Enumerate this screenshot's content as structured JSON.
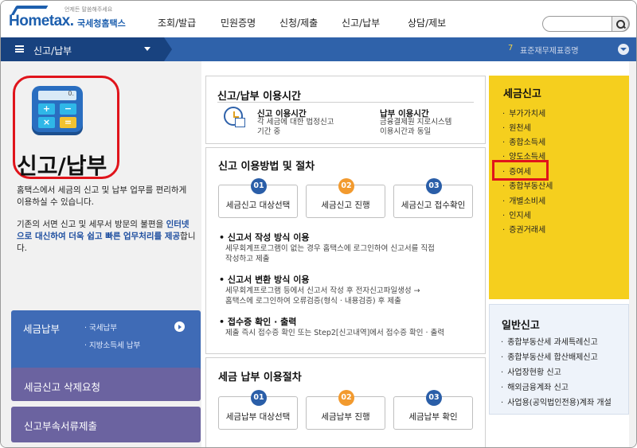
{
  "header": {
    "logo_main": "Hometax.",
    "logo_sub": "국세청홈택스",
    "logo_tagline": "언제든 말씀해주세요",
    "nav": [
      "조회/발급",
      "민원증명",
      "신청/제출",
      "신고/납부",
      "상담/제보"
    ],
    "search_placeholder": ""
  },
  "menubar": {
    "title": "신고/납부",
    "notice_num": "7",
    "notice_text": "표준재무제표증명"
  },
  "left": {
    "calc_display": "0.",
    "big_title": "신고/납부",
    "intro": "홈택스에서 세금의 신고 및 납부 업무를 편리하게 이용하실 수 있습니다.",
    "intro2_a": "기존의 서면 신고 및 세무서 방문의 불편을",
    "intro2_b": "인터넷으로 대신하여 더욱 쉽고 빠른",
    "intro2_c": "업무처리를 제공",
    "intro2_d": "합니다.",
    "tax_title": "세금납부",
    "tax_sub1": "· 국세납부",
    "tax_sub2": "· 지방소득세 납부",
    "delete_title": "세금신고 삭제요청",
    "attach_title": "신고부속서류제출"
  },
  "hours": {
    "title": "신고/납부 이용시간",
    "report_title": "신고 이용시간",
    "report_desc1": "각 세금에 대한 법정신고",
    "report_desc2": "기간 중",
    "pay_title": "납부 이용시간",
    "pay_desc1": "금융결제원 지로시스템",
    "pay_desc2": "이용시간과 동일"
  },
  "method": {
    "title": "신고 이용방법 및 절차",
    "steps": [
      {
        "num": "01",
        "label": "세금신고 대상선택"
      },
      {
        "num": "02",
        "label": "세금신고 진행"
      },
      {
        "num": "03",
        "label": "세금신고 접수확인"
      }
    ],
    "b1_title": "신고서 작성 방식 이용",
    "b1_l1": "세무회계프로그램이 없는 경우 홈택스에 로그인하여 신고서를 직접",
    "b1_l2": "작성하고 제출",
    "b2_title": "신고서 변환 방식 이용",
    "b2_l1": "세무회계프로그램 등에서 신고서 작성 후 전자신고파일생성 →",
    "b2_l2": "홈택스에 로그인하여 오류검증(형식 · 내용검증) 후 제출",
    "b3_title": "접수증 확인 · 출력",
    "b3_l1": "제출 즉시 접수증 확인 또는 Step2[신고내역]에서 접수증 확인 · 출력"
  },
  "payment": {
    "title": "세금 납부 이용절차",
    "steps": [
      {
        "num": "01",
        "label": "세금납부 대상선택"
      },
      {
        "num": "02",
        "label": "세금납부 진행"
      },
      {
        "num": "03",
        "label": "세금납부 확인"
      }
    ]
  },
  "tax_report": {
    "title": "세금신고",
    "items": [
      "부가가치세",
      "원천세",
      "종합소득세",
      "양도소득세",
      "증여세",
      "종합부동산세",
      "개별소비세",
      "인지세",
      "증권거래세"
    ]
  },
  "general_report": {
    "title": "일반신고",
    "items": [
      "종합부동산세 과세특례신고",
      "종합부동산세 합산배제신고",
      "사업장현황 신고",
      "해외금융계좌 신고",
      "사업용(공익법인전용)계좌 개설"
    ]
  },
  "colors": {
    "brand_blue": "#1d5fae",
    "menubar": "#2f62aa",
    "highlight_red": "#e0141b",
    "tax_yellow": "#f5cf1e",
    "purple_button": "#6b63a0"
  }
}
